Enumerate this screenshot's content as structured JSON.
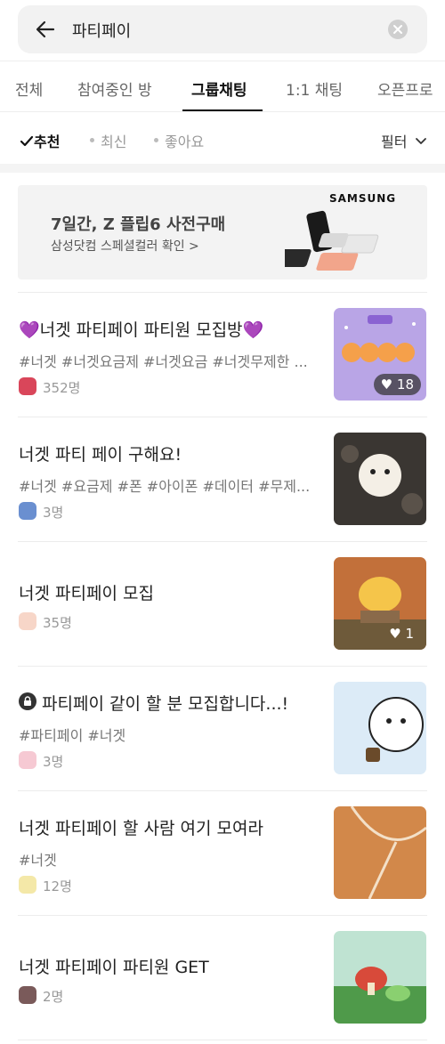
{
  "search": {
    "query": "파티페이"
  },
  "tabs": [
    {
      "label": "전체"
    },
    {
      "label": "참여중인 방"
    },
    {
      "label": "그룹채팅"
    },
    {
      "label": "1:1 채팅"
    },
    {
      "label": "오픈프로"
    }
  ],
  "active_tab": "그룹채팅",
  "sort": {
    "options": [
      {
        "label": "추천"
      },
      {
        "label": "최신"
      },
      {
        "label": "좋아요"
      }
    ],
    "selected": "추천",
    "filter_label": "필터"
  },
  "ad": {
    "title": "7일간, Z 플립6 사전구매",
    "subtitle": "삼성닷컴 스페셜컬러 확인 >",
    "brand": "SAMSUNG"
  },
  "rooms": [
    {
      "title": "💜너겟 파티페이 파티원 모집방💜",
      "tags": "#너겟 #너겟요금제 #너겟요금 #너겟무제한 ...",
      "members": "352명",
      "likes": "18"
    },
    {
      "title": "너겟 파티 페이 구해요!",
      "tags": "#너겟 #요금제 #폰 #아이폰 #데이터 #무제...",
      "members": "3명",
      "likes": ""
    },
    {
      "title": "너겟 파티페이 모집",
      "tags": "",
      "members": "35명",
      "likes": "1"
    },
    {
      "title": "파티페이 같이 할 분 모집합니다...!",
      "tags": "#파티페이 #너겟",
      "members": "3명",
      "likes": "",
      "locked": true
    },
    {
      "title": "너겟 파티페이 할 사람 여기 모여라",
      "tags": "#너겟",
      "members": "12명",
      "likes": ""
    },
    {
      "title": "너겟 파티페이 파티원 GET",
      "tags": "",
      "members": "2명",
      "likes": ""
    }
  ],
  "colors": {
    "accent": "#111111",
    "tag": "#777777",
    "count": "#999999",
    "divider": "#ececec"
  }
}
